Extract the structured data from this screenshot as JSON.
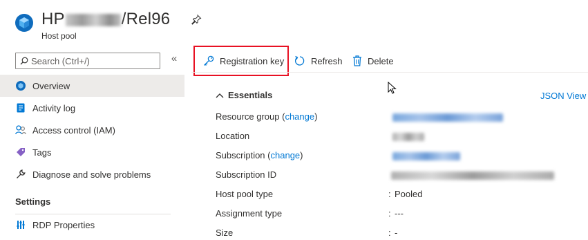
{
  "header": {
    "title_prefix": "HP",
    "title_suffix": "/Rel96",
    "subtitle": "Host pool",
    "resource_icon": "host-pool-icon",
    "pin_icon": "pin-icon"
  },
  "sidebar": {
    "search_placeholder": "Search (Ctrl+/)",
    "collapse_glyph": "«",
    "items": [
      {
        "label": "Overview",
        "icon": "overview-icon"
      },
      {
        "label": "Activity log",
        "icon": "activity-log-icon"
      },
      {
        "label": "Access control (IAM)",
        "icon": "access-control-icon"
      },
      {
        "label": "Tags",
        "icon": "tag-icon"
      },
      {
        "label": "Diagnose and solve problems",
        "icon": "wrench-icon"
      }
    ],
    "section_title": "Settings",
    "settings_items": [
      {
        "label": "RDP Properties",
        "icon": "rdp-properties-icon"
      }
    ]
  },
  "toolbar": {
    "registration_key": "Registration key",
    "refresh": "Refresh",
    "delete": "Delete"
  },
  "essentials": {
    "title": "Essentials",
    "json_view": "JSON View",
    "change_link": "change",
    "rows": [
      {
        "label": "Resource group",
        "value": ""
      },
      {
        "label": "Location",
        "value": ""
      },
      {
        "label": "Subscription",
        "value": ""
      },
      {
        "label": "Subscription ID",
        "value": ""
      },
      {
        "label": "Host pool type",
        "value": "Pooled"
      },
      {
        "label": "Assignment type",
        "value": "---"
      },
      {
        "label": "Size",
        "value": "-"
      }
    ]
  },
  "colors": {
    "accent": "#0078d4",
    "highlight_border": "#e81123",
    "active_nav": "#edebe9"
  }
}
